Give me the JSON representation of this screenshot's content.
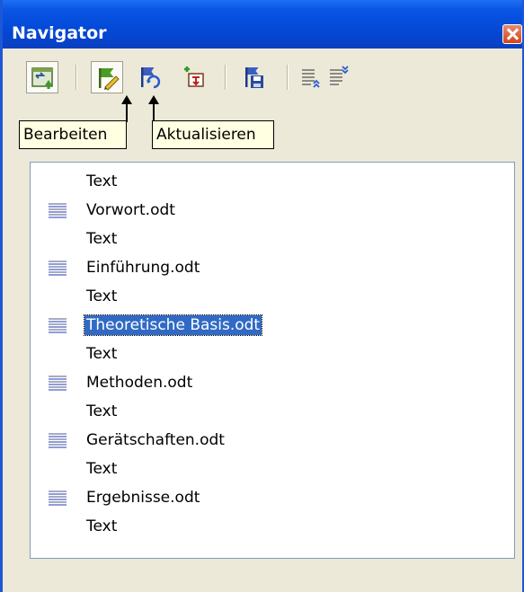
{
  "window": {
    "title": "Navigator"
  },
  "toolbar": {
    "buttons": [
      {
        "icon": "navigator-toggle-icon"
      },
      {
        "icon": "edit-flag-icon"
      },
      {
        "icon": "update-flag-icon"
      },
      {
        "icon": "insert-icon"
      },
      {
        "icon": "save-as-icon"
      },
      {
        "icon": "move-up-icon"
      },
      {
        "icon": "move-down-icon"
      }
    ]
  },
  "tooltips": {
    "edit": "Bearbeiten",
    "update": "Aktualisieren"
  },
  "tree": {
    "items": [
      {
        "label": "Text",
        "icon": false,
        "selected": false
      },
      {
        "label": "Vorwort.odt",
        "icon": true,
        "selected": false
      },
      {
        "label": "Text",
        "icon": false,
        "selected": false
      },
      {
        "label": "Einführung.odt",
        "icon": true,
        "selected": false
      },
      {
        "label": "Text",
        "icon": false,
        "selected": false
      },
      {
        "label": "Theoretische Basis.odt",
        "icon": true,
        "selected": true
      },
      {
        "label": "Text",
        "icon": false,
        "selected": false
      },
      {
        "label": "Methoden.odt",
        "icon": true,
        "selected": false
      },
      {
        "label": "Text",
        "icon": false,
        "selected": false
      },
      {
        "label": "Gerätschaften.odt",
        "icon": true,
        "selected": false
      },
      {
        "label": "Text",
        "icon": false,
        "selected": false
      },
      {
        "label": "Ergebnisse.odt",
        "icon": true,
        "selected": false
      },
      {
        "label": "Text",
        "icon": false,
        "selected": false
      }
    ]
  },
  "colors": {
    "selection": "#316ac5",
    "titlebar": "#0a55e5",
    "tooltip_bg": "#ffffe1"
  }
}
